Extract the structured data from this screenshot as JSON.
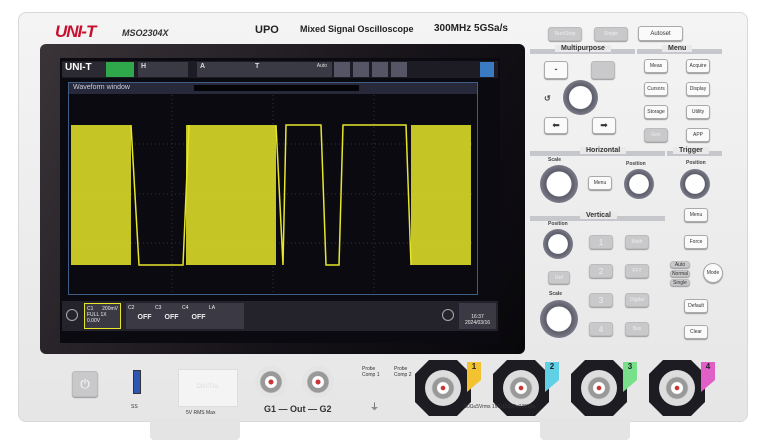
{
  "header": {
    "brand": "UNI-T",
    "model": "MSO2304X",
    "tech": "UPO",
    "description": "Mixed Signal Oscilloscope",
    "spec": "300MHz  5GSa/s"
  },
  "screen": {
    "logo": "UNI-T",
    "run_state": "",
    "window_title": "Waveform window",
    "status": {
      "h_label": "H",
      "a_label": "A",
      "t_label": "T",
      "trigger_mode": "Auto"
    },
    "channels": [
      {
        "name": "C1",
        "detail": [
          "200mV",
          "FULL",
          "1X",
          "0.00V"
        ]
      },
      {
        "name": "C2",
        "state": "OFF"
      },
      {
        "name": "C3",
        "state": "OFF"
      },
      {
        "name": "C4",
        "state": "OFF"
      },
      {
        "name": "LA"
      }
    ],
    "time": "16:37",
    "date": "2024/03/16",
    "trace_color": "#e6e62a"
  },
  "top_buttons": [
    "Run/Stop",
    "Single",
    "Autoset"
  ],
  "multipurpose": {
    "title": "Multipurpose",
    "menu_title": "Menu",
    "menu_buttons": [
      "Meas",
      "Acquire",
      "Cursors",
      "Display",
      "Storage",
      "Utility",
      "Gen",
      "APP"
    ]
  },
  "horizontal": {
    "title": "Horizontal",
    "scale": "Scale",
    "menu": "Menu",
    "position": "Position"
  },
  "trigger": {
    "title": "Trigger",
    "position": "Position",
    "menu": "Menu",
    "force": "Force",
    "modes": [
      "Auto",
      "Normal",
      "Single"
    ],
    "mode_button": "Mode"
  },
  "vertical": {
    "title": "Vertical",
    "position": "Position",
    "scale": "Scale",
    "ref": "Ref",
    "channel_buttons": [
      "1",
      "2",
      "3",
      "4"
    ],
    "func_buttons": [
      "Math",
      "FFT",
      "Digital",
      "Bus"
    ]
  },
  "bottom_buttons": [
    "Default",
    "Clear"
  ],
  "front": {
    "usb": "SS",
    "digital": "DIGITAL",
    "digital_note": "5V RMS Max",
    "gen_label": "G1 — Out — G2",
    "probe_comp": [
      "Probe Comp 1",
      "Probe Comp 2"
    ],
    "input_rating": "50Ω≤5Vrms  1MΩ‖16pF≤135Vpk",
    "channel_tags": [
      {
        "n": "1",
        "color": "#f2c230"
      },
      {
        "n": "2",
        "color": "#5fd0e6"
      },
      {
        "n": "3",
        "color": "#78e08a"
      },
      {
        "n": "4",
        "color": "#e060c8"
      }
    ]
  }
}
